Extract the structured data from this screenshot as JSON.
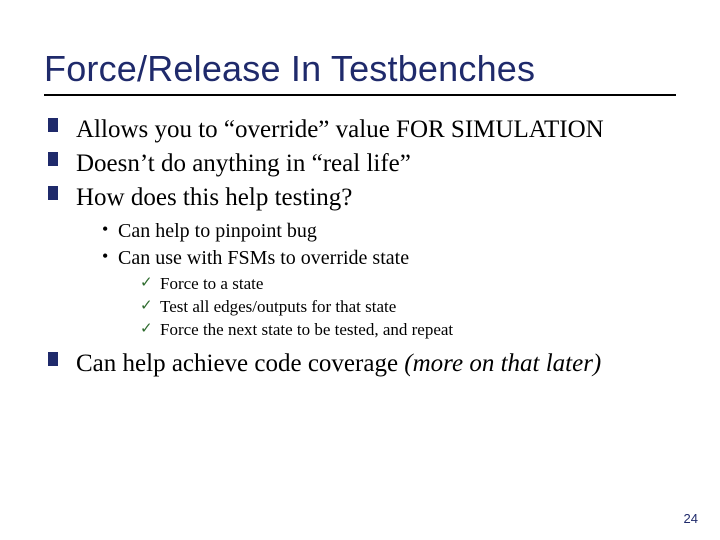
{
  "title": "Force/Release In Testbenches",
  "bullets": {
    "b1": "Allows you to “override” value FOR SIMULATION",
    "b2": "Doesn’t do anything in “real life”",
    "b3": "How does this help testing?",
    "sub": {
      "s1": "Can help to pinpoint bug",
      "s2": "Can use with FSMs to override state",
      "chk": {
        "c1": "Force to a state",
        "c2": "Test all edges/outputs for that state",
        "c3": "Force the next state to be tested, and repeat"
      }
    },
    "b4a": "Can help achieve code coverage ",
    "b4b": "(more on that later)"
  },
  "page_number": "24"
}
